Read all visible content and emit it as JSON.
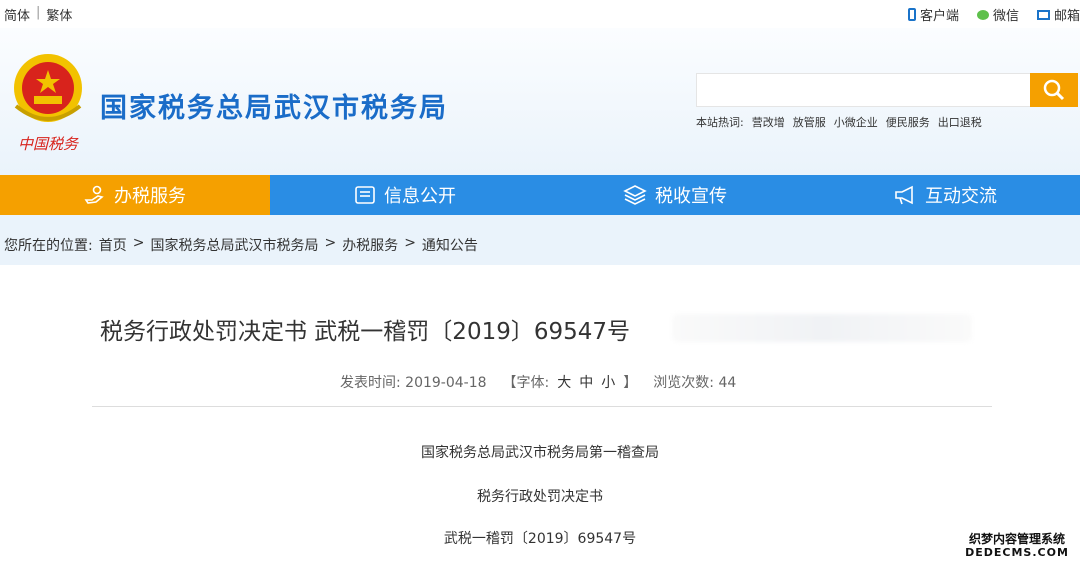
{
  "topbar": {
    "lang_simplified": "简体",
    "lang_separator": "|",
    "lang_traditional": "繁体",
    "links": [
      {
        "icon": "phone-icon",
        "label": "客户端"
      },
      {
        "icon": "wechat-icon",
        "label": "微信"
      },
      {
        "icon": "mail-icon",
        "label": "邮箱"
      }
    ]
  },
  "header": {
    "logo_text": "中国税务",
    "site_title": "国家税务总局武汉市税务局",
    "search": {
      "placeholder": ""
    },
    "hot_label": "本站热词:",
    "hot_words": [
      "营改增",
      "放管服",
      "小微企业",
      "便民服务",
      "出口退税"
    ]
  },
  "nav": {
    "items": [
      {
        "label": "办税服务",
        "icon": "hand-service-icon",
        "active": true
      },
      {
        "label": "信息公开",
        "icon": "info-card-icon",
        "active": false
      },
      {
        "label": "税收宣传",
        "icon": "layers-icon",
        "active": false
      },
      {
        "label": "互动交流",
        "icon": "megaphone-icon",
        "active": false
      }
    ]
  },
  "breadcrumb": {
    "label": "您所在的位置:",
    "items": [
      "首页",
      "国家税务总局武汉市税务局",
      "办税服务",
      "通知公告"
    ],
    "separator": ">"
  },
  "article": {
    "title": "税务行政处罚决定书 武税一稽罚〔2019〕69547号",
    "published_label": "发表时间:",
    "published_date": "2019-04-18",
    "font_label": "【字体:",
    "font_sizes": [
      "大",
      "中",
      "小"
    ],
    "font_close": "】",
    "views_label": "浏览次数:",
    "views": "44",
    "body_lines": [
      "国家税务总局武汉市税务局第一稽查局",
      "税务行政处罚决定书",
      "武税一稽罚〔2019〕69547号"
    ]
  },
  "watermark": {
    "line1": "织梦内容管理系统",
    "line2": "DEDECMS.COM"
  },
  "colors": {
    "nav_blue": "#2a8de4",
    "active_orange": "#f5a000",
    "title_blue": "#1a6cc8"
  }
}
